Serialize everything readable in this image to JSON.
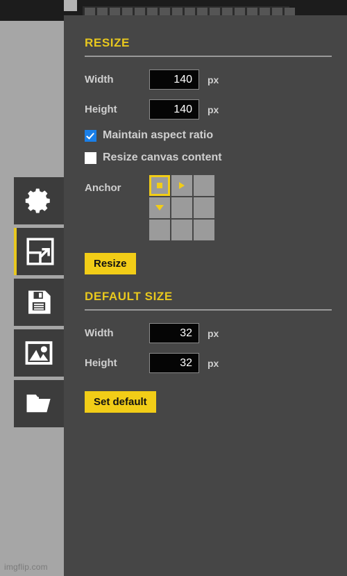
{
  "app": {
    "watermark": "imgflip.com",
    "accent_yellow": "#f2cd17",
    "panel_bg": "#464646",
    "canvas_bg": "#a6a6a6",
    "checkbox_blue": "#1a7fe8",
    "anchor_cell_gray": "#9b9b9b"
  },
  "toolbar": {
    "cell_count": 17
  },
  "sidebar": {
    "items": [
      {
        "name": "settings",
        "icon": "gear-icon",
        "active": false
      },
      {
        "name": "resize",
        "icon": "resize-icon",
        "active": true
      },
      {
        "name": "save",
        "icon": "floppy-disk-icon",
        "active": false
      },
      {
        "name": "image",
        "icon": "image-icon",
        "active": false
      },
      {
        "name": "open",
        "icon": "folder-icon",
        "active": false
      }
    ]
  },
  "resize_section": {
    "title": "RESIZE",
    "width_label": "Width",
    "width_value": "140",
    "width_unit": "px",
    "height_label": "Height",
    "height_value": "140",
    "height_unit": "px",
    "maintain_aspect_label": "Maintain aspect ratio",
    "maintain_aspect_checked": true,
    "resize_canvas_label": "Resize canvas content",
    "resize_canvas_checked": false,
    "anchor_label": "Anchor",
    "anchor_cells": [
      {
        "pos": "top-left",
        "selected": true,
        "glyph": "dot"
      },
      {
        "pos": "top-center",
        "selected": false,
        "glyph": "arrow-right"
      },
      {
        "pos": "top-right",
        "selected": false,
        "glyph": "none"
      },
      {
        "pos": "middle-left",
        "selected": false,
        "glyph": "arrow-down"
      },
      {
        "pos": "middle-center",
        "selected": false,
        "glyph": "none"
      },
      {
        "pos": "middle-right",
        "selected": false,
        "glyph": "none"
      },
      {
        "pos": "bottom-left",
        "selected": false,
        "glyph": "none"
      },
      {
        "pos": "bottom-center",
        "selected": false,
        "glyph": "none"
      },
      {
        "pos": "bottom-right",
        "selected": false,
        "glyph": "none"
      }
    ],
    "resize_button_label": "Resize"
  },
  "default_size_section": {
    "title": "DEFAULT SIZE",
    "width_label": "Width",
    "width_value": "32",
    "width_unit": "px",
    "height_label": "Height",
    "height_value": "32",
    "height_unit": "px",
    "set_default_button_label": "Set default"
  }
}
